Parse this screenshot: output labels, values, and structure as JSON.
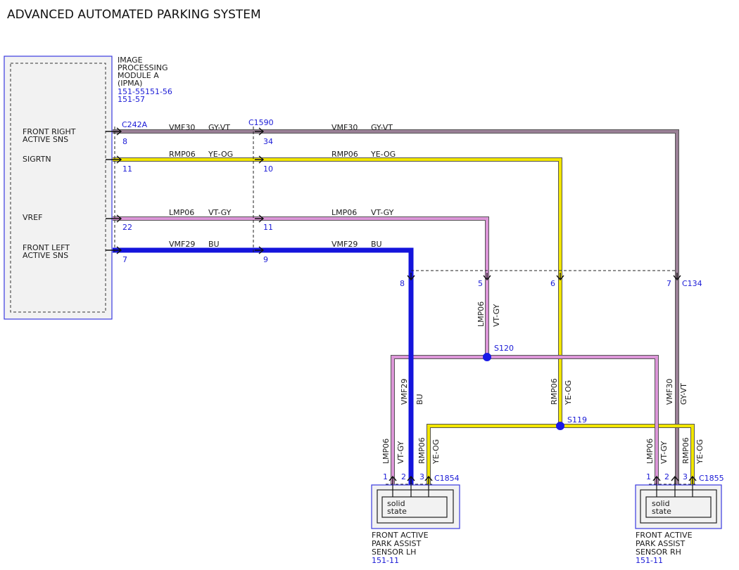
{
  "title": "ADVANCED AUTOMATED PARKING SYSTEM",
  "module": {
    "name_lines": [
      "IMAGE",
      "PROCESSING",
      "MODULE A",
      "(IPMA)"
    ],
    "ref_lines": [
      "151-55151-56",
      "151-57"
    ],
    "signals": [
      "FRONT RIGHT",
      "ACTIVE SNS",
      "SIGRTN",
      "VREF",
      "FRONT LEFT",
      "ACTIVE SNS"
    ]
  },
  "connectors": {
    "c242a": {
      "name": "C242A",
      "pins": [
        "8",
        "11",
        "22",
        "7"
      ]
    },
    "c1590": {
      "name": "C1590",
      "pins": [
        "34",
        "10",
        "11",
        "9"
      ]
    },
    "c134": {
      "name": "C134",
      "pins": [
        "8",
        "5",
        "6",
        "7"
      ]
    },
    "c1854": {
      "name": "C1854",
      "pins": [
        "1",
        "2",
        "3"
      ]
    },
    "c1855": {
      "name": "C1855",
      "pins": [
        "1",
        "2",
        "3"
      ]
    }
  },
  "circuits": {
    "vmf30": {
      "id": "VMF30",
      "color": "GY-VT",
      "hex": "#9a8096"
    },
    "rmp06": {
      "id": "RMP06",
      "color": "YE-OG",
      "hex": "#f2e600"
    },
    "lmp06": {
      "id": "LMP06",
      "color": "VT-GY",
      "hex": "#dc96d8"
    },
    "vmf29": {
      "id": "VMF29",
      "color": "BU",
      "hex": "#1414dc"
    }
  },
  "splices": [
    "S120",
    "S119"
  ],
  "sensors": {
    "lh": {
      "inner": [
        "solid",
        "state"
      ],
      "name_lines": [
        "FRONT ACTIVE",
        "PARK ASSIST",
        "SENSOR LH"
      ],
      "ref": "151-11"
    },
    "rh": {
      "inner": [
        "solid",
        "state"
      ],
      "name_lines": [
        "FRONT ACTIVE",
        "PARK ASSIST",
        "SENSOR RH"
      ],
      "ref": "151-11"
    }
  }
}
